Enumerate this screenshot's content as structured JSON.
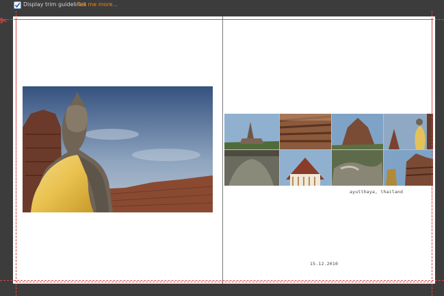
{
  "toolbar": {
    "checkbox_checked": true,
    "trim_label": "Display trim guidelines",
    "tell_more": "Tell me more..."
  },
  "spread": {
    "right_page": {
      "caption": "ayutthaya, thailand",
      "date": "15.12.2010"
    }
  },
  "colors": {
    "background": "#3c3c3c",
    "trim_line": "#d94545",
    "link": "#e98a1c"
  },
  "icons": {
    "checkbox": "checkmark-icon",
    "scissors": "scissors-icon"
  }
}
